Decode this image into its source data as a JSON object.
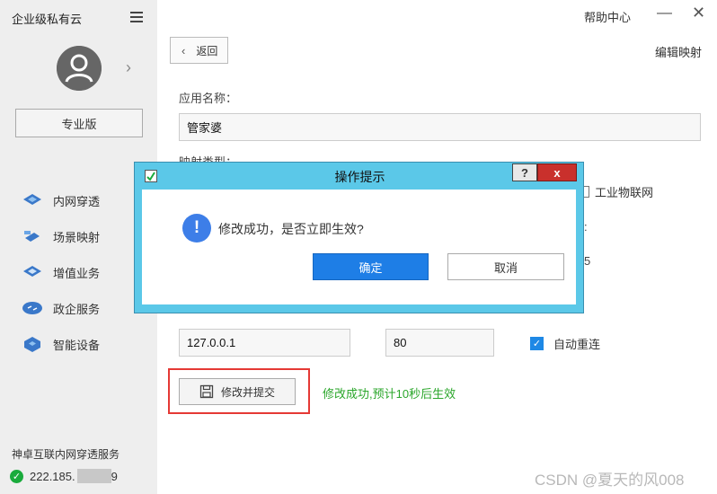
{
  "app": {
    "title": "企业级私有云",
    "help_label": "帮助中心",
    "minimize_glyph": "—",
    "close_glyph": "✕"
  },
  "sidebar": {
    "pro_label": "专业版",
    "items": [
      {
        "label": "内网穿透",
        "icon": "network-icon"
      },
      {
        "label": "场景映射",
        "icon": "scene-map-icon"
      },
      {
        "label": "增值业务",
        "icon": "value-added-icon"
      },
      {
        "label": "政企服务",
        "icon": "gov-service-icon"
      },
      {
        "label": "智能设备",
        "icon": "smart-device-icon"
      }
    ],
    "service_title": "神卓互联内网穿透服务",
    "ip_prefix": "222.185.",
    "ip_suffix": "9"
  },
  "main": {
    "back_label": "返回",
    "edit_title": "编辑映射",
    "app_name_label": "应用名称：",
    "app_name_value": "管家婆",
    "map_type_label": "映射类型：",
    "iot_label": "工业物联网",
    "partial_colon": ":",
    "partial_five": "5",
    "local_ip_value": "127.0.0.1",
    "local_port_value": "80",
    "auto_reconnect_label": "自动重连",
    "submit_label": "修改并提交",
    "status_message": "修改成功,预计10秒后生效"
  },
  "dialog": {
    "title": "操作提示",
    "help_glyph": "?",
    "close_glyph": "x",
    "message": "修改成功，是否立即生效?",
    "confirm_label": "确定",
    "cancel_label": "取消"
  },
  "watermark": "CSDN @夏天的风008",
  "colors": {
    "accent": "#1e7ee6",
    "dialog_border": "#5bc8e8",
    "success": "#2aa62a",
    "highlight": "#e53935"
  }
}
